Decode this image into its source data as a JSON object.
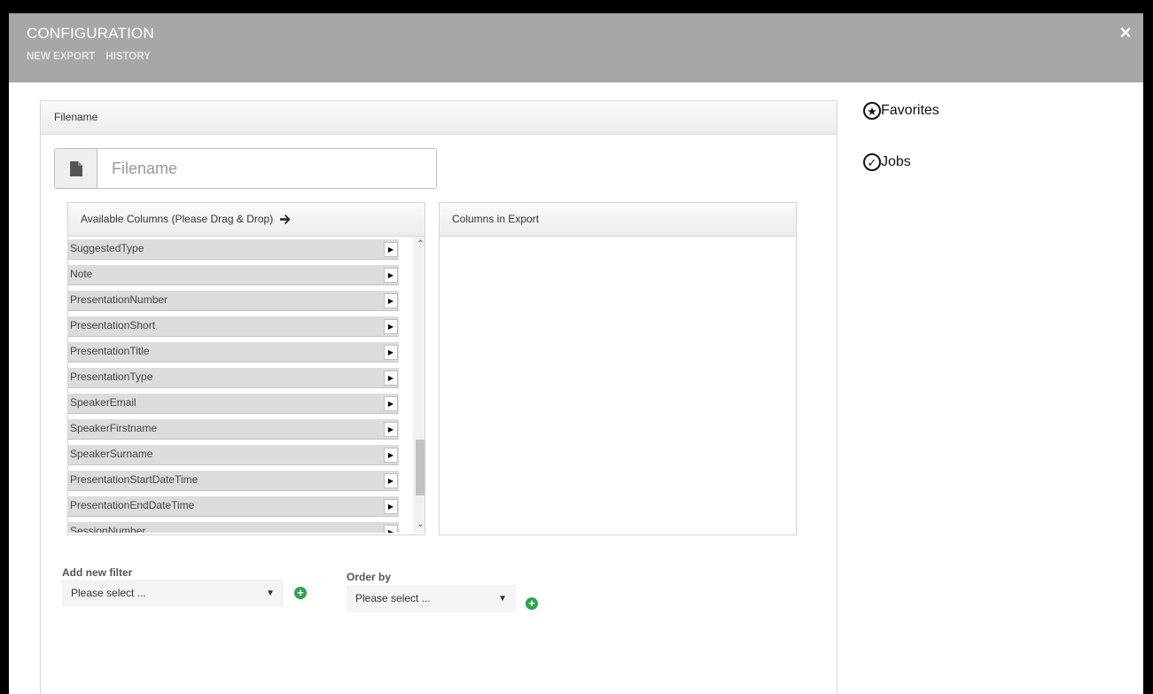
{
  "modal": {
    "title": "CONFIGURATION",
    "tabs": [
      "NEW EXPORT",
      "HISTORY"
    ],
    "close_symbol": "×"
  },
  "filename_panel": {
    "title": "Filename",
    "placeholder": "Filename",
    "value": "",
    "icon": "file-icon"
  },
  "available_columns": {
    "title": "Available Columns (Please Drag & Drop)",
    "title_icon": "arrow-right-icon",
    "items": [
      "SuggestedType",
      "Note",
      "PresentationNumber",
      "PresentationShort",
      "PresentationTitle",
      "PresentationType",
      "SpeakerEmail",
      "SpeakerFirstname",
      "SpeakerSurname",
      "PresentationStartDateTime",
      "PresentationEndDateTime",
      "SessionNumber"
    ]
  },
  "export_columns": {
    "title": "Columns in Export",
    "items": []
  },
  "filter": {
    "label": "Add new filter",
    "selected": "Please select ..."
  },
  "order_by": {
    "label": "Order by",
    "selected": "Please select ..."
  },
  "sidebar": {
    "favorites": "Favorites",
    "jobs": "Jobs"
  },
  "colors": {
    "header": "#a7a7a7",
    "add_button": "#2da44a",
    "list_item": "#dcdcdc"
  }
}
